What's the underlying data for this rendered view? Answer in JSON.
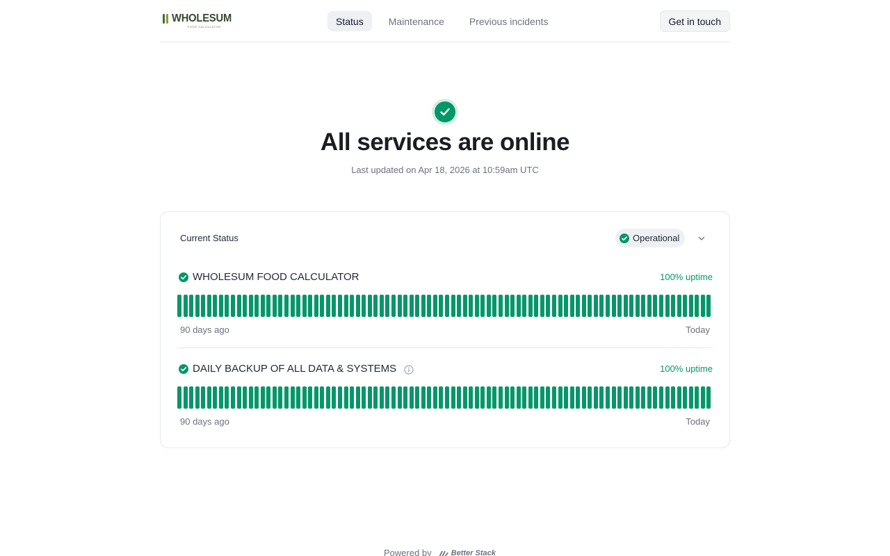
{
  "header": {
    "logo": {
      "word": "WHOLESUM",
      "sub": "FOOD CALCULATOR"
    },
    "nav": [
      {
        "label": "Status",
        "active": true
      },
      {
        "label": "Maintenance",
        "active": false
      },
      {
        "label": "Previous incidents",
        "active": false
      }
    ],
    "contact_label": "Get in touch"
  },
  "hero": {
    "icon": "check-circle-icon",
    "title": "All services are online",
    "subtitle": "Last updated on Apr 18, 2026 at 10:59am UTC"
  },
  "status_card": {
    "label": "Current Status",
    "status": "Operational",
    "monitors": [
      {
        "name": "WHOLESUM FOOD CALCULATOR",
        "uptime": "100% uptime",
        "has_info": false,
        "range_start": "90 days ago",
        "range_end": "Today",
        "days_up": 90
      },
      {
        "name": "DAILY BACKUP OF ALL DATA & SYSTEMS",
        "uptime": "100% uptime",
        "has_info": true,
        "range_start": "90 days ago",
        "range_end": "Today",
        "days_up": 90
      }
    ]
  },
  "footer": {
    "powered_label": "Powered by",
    "brand": "Better Stack"
  },
  "colors": {
    "operational": "#059669",
    "operational_light": "#d1efe2"
  }
}
